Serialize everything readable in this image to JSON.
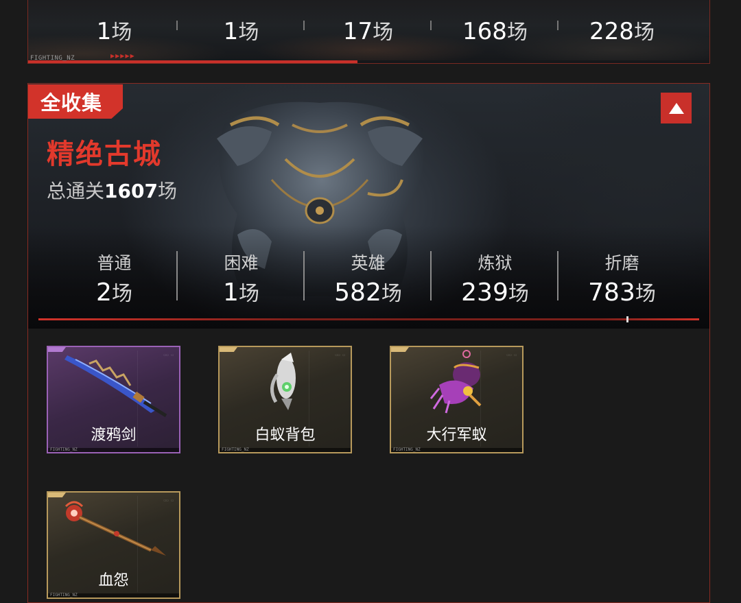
{
  "previous_map": {
    "stats": [
      {
        "count": "1",
        "unit": "场"
      },
      {
        "count": "1",
        "unit": "场"
      },
      {
        "count": "17",
        "unit": "场"
      },
      {
        "count": "168",
        "unit": "场"
      },
      {
        "count": "228",
        "unit": "场"
      }
    ],
    "footer_text": "FIGHTING_NZ"
  },
  "map": {
    "badge": "全收集",
    "title": "精绝古城",
    "total_prefix": "总通关",
    "total_count": "1607",
    "total_unit": "场",
    "collapse_icon": "triangle-up-icon",
    "difficulties": [
      {
        "label": "普通",
        "count": "2",
        "unit": "场"
      },
      {
        "label": "困难",
        "count": "1",
        "unit": "场"
      },
      {
        "label": "英雄",
        "count": "582",
        "unit": "场"
      },
      {
        "label": "炼狱",
        "count": "239",
        "unit": "场"
      },
      {
        "label": "折磨",
        "count": "783",
        "unit": "场"
      }
    ]
  },
  "items": [
    {
      "name": "渡鸦剑",
      "rarity": "purple",
      "footer": "FIGHTING_NZ"
    },
    {
      "name": "白蚁背包",
      "rarity": "gold",
      "footer": "FIGHTING_NZ"
    },
    {
      "name": "大行军蚁",
      "rarity": "gold",
      "footer": "FIGHTING_NZ"
    },
    {
      "name": "血怨",
      "rarity": "gold",
      "footer": "FIGHTING_NZ"
    }
  ],
  "colors": {
    "accent_red": "#d2332a",
    "title_red": "#e2392c",
    "gold_border": "#b89a5c",
    "purple_border": "#9b62b7",
    "background": "#1a1a1a"
  }
}
